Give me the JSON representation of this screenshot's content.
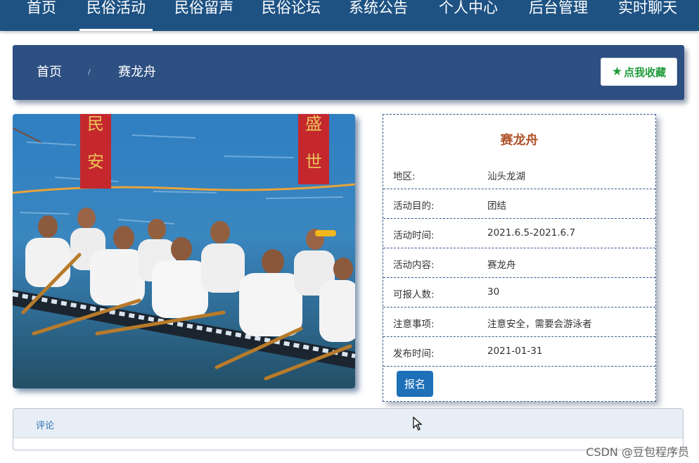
{
  "nav": {
    "items": [
      {
        "label": "首页"
      },
      {
        "label": "民俗活动"
      },
      {
        "label": "民俗留声"
      },
      {
        "label": "民俗论坛"
      },
      {
        "label": "系统公告"
      },
      {
        "label": "个人中心"
      },
      {
        "label": "后台管理"
      },
      {
        "label": "实时聊天"
      }
    ],
    "active": "民俗活动"
  },
  "breadcrumb": {
    "home": "首页",
    "separator": "/",
    "current": "赛龙舟"
  },
  "favorite_button": {
    "label": "点我收藏",
    "icon": "star-icon"
  },
  "photo": {
    "banner_left": "民安",
    "banner_right": "盛世"
  },
  "activity": {
    "title": "赛龙舟",
    "rows": [
      {
        "label": "地区:",
        "value": "汕头龙湖"
      },
      {
        "label": "活动目的:",
        "value": "团结"
      },
      {
        "label": "活动时间:",
        "value": "2021.6.5-2021.6.7"
      },
      {
        "label": "活动内容:",
        "value": "赛龙舟"
      },
      {
        "label": "可报人数:",
        "value": "30"
      },
      {
        "label": "注意事项:",
        "value": "注意安全，需要会游泳者"
      },
      {
        "label": "发布时间:",
        "value": "2021-01-31"
      }
    ],
    "signup_label": "报名"
  },
  "comment": {
    "tab_label": "评论"
  },
  "watermark": "CSDN @豆包程序员",
  "colors": {
    "nav_bg": "#1e5283",
    "crumb_bg": "#2d4f82",
    "title": "#b0552c",
    "fav": "#1f9b3a",
    "signup": "#1e70b8"
  }
}
